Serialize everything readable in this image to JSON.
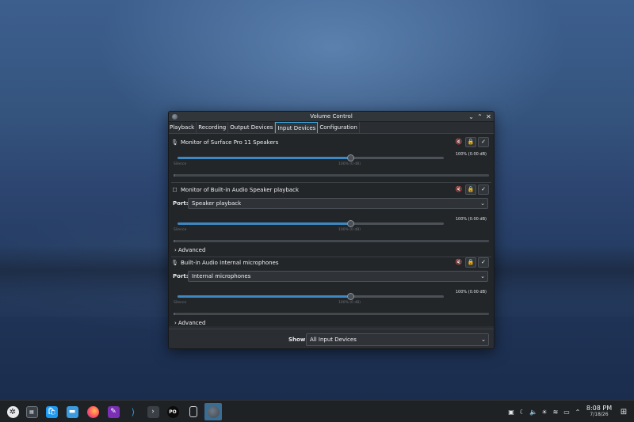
{
  "window": {
    "title": "Volume Control",
    "controls": [
      "⌄",
      "⌃",
      "✕"
    ]
  },
  "tabs": [
    {
      "label": "Playback",
      "active": false
    },
    {
      "label": "Recording",
      "active": false
    },
    {
      "label": "Output Devices",
      "active": false
    },
    {
      "label": "Input Devices",
      "active": true
    },
    {
      "label": "Configuration",
      "active": false
    }
  ],
  "devices": [
    {
      "name": "Monitor of Surface Pro 11 Speakers",
      "icon": "microphone-icon",
      "volume_percent": 100,
      "volume_label": "100% (0.00 dB)",
      "scale_low": "Silence",
      "scale_mid": "100% (0 dB)"
    },
    {
      "name": "Monitor of Built-in Audio Speaker playback",
      "icon": "checkbox-icon",
      "port_label": "Port:",
      "port_value": "Speaker playback",
      "volume_percent": 100,
      "volume_label": "100% (0.00 dB)",
      "scale_low": "Silence",
      "scale_mid": "100% (0 dB)",
      "advanced_label": "Advanced"
    },
    {
      "name": "Built-in Audio Internal microphones",
      "icon": "microphone-icon",
      "port_label": "Port:",
      "port_value": "Internal microphones",
      "volume_percent": 100,
      "volume_label": "100% (0.00 dB)",
      "scale_low": "Silence",
      "scale_mid": "100% (0 dB)",
      "advanced_label": "Advanced"
    }
  ],
  "footer": {
    "show_label": "Show:",
    "show_value": "All Input Devices"
  },
  "taskbar": {
    "clock_time": "8:08 PM",
    "clock_date": "7/18/26"
  },
  "colors": {
    "accent": "#3daee9",
    "slider_fill": "#3d88c2",
    "window_bg": "#232629"
  }
}
